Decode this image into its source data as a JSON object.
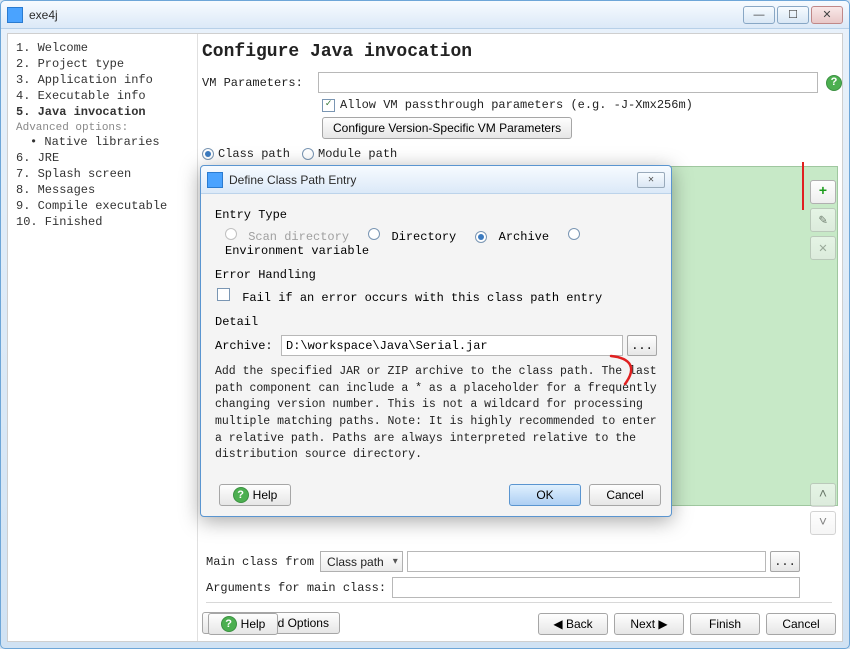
{
  "window": {
    "title": "exe4j"
  },
  "winbuttons": {
    "min": "—",
    "max": "☐",
    "close": "✕"
  },
  "sidebar": {
    "steps": [
      "1. Welcome",
      "2. Project type",
      "3. Application info",
      "4. Executable info",
      "5. Java invocation"
    ],
    "advanced_label": "Advanced options:",
    "advanced_items": [
      "• Native libraries"
    ],
    "steps2": [
      "6. JRE",
      "7. Splash screen",
      "8. Messages",
      "9. Compile executable",
      "10. Finished"
    ],
    "current_index": 4
  },
  "main": {
    "heading": "Configure Java invocation",
    "vm_params_label": "VM Parameters:",
    "vm_params_value": "",
    "allow_passthrough_label": "Allow VM passthrough parameters (e.g. -J-Xmx256m)",
    "allow_passthrough_checked": true,
    "configure_vs_btn": "Configure Version-Specific VM Parameters",
    "path_mode": {
      "classpath": "Class path",
      "modulepath": "Module path",
      "selected": "classpath"
    },
    "sidebtn": {
      "add": "+",
      "edit": "✎",
      "delete": "✕",
      "up": "˄",
      "down": "˅"
    },
    "main_class_label": "Main class from",
    "main_class_select": "Class path",
    "main_class_value": "",
    "args_label": "Arguments for main class:",
    "args_value": "",
    "adv_opts": "Advanced Options",
    "dots": "...",
    "help": "Help",
    "nav": {
      "back": "◀  Back",
      "next": "Next  ▶",
      "finish": "Finish",
      "cancel": "Cancel"
    }
  },
  "dialog": {
    "title": "Define Class Path Entry",
    "entry_type_label": "Entry Type",
    "types": {
      "scan": "Scan directory",
      "dir": "Directory",
      "archive": "Archive",
      "env": "Environment variable",
      "selected": "archive"
    },
    "err_label": "Error Handling",
    "err_check_label": "Fail if an error occurs with this class path entry",
    "err_checked": false,
    "detail_label": "Detail",
    "archive_label": "Archive:",
    "archive_value": "D:\\workspace\\Java\\Serial.jar",
    "dots": "...",
    "desc": "Add the specified JAR or ZIP archive to the class path. The last path component can include a * as a placeholder for a frequently changing version number. This is not a wildcard for processing multiple matching paths. Note: It is highly recommended to enter a relative path. Paths are always interpreted relative to the distribution source directory.",
    "help": "Help",
    "ok": "OK",
    "cancel": "Cancel"
  },
  "watermark": "exe4j"
}
